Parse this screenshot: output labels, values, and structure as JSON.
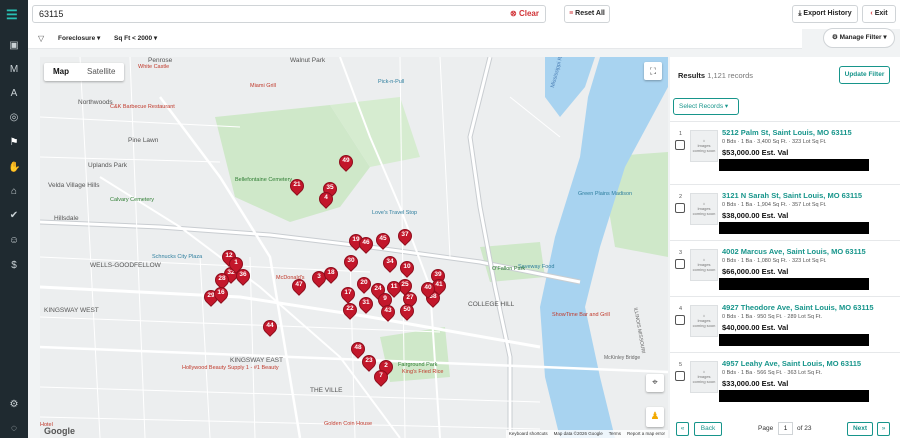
{
  "nav": {
    "logo": "☰",
    "items": [
      {
        "name": "dashboard-icon",
        "glyph": "▣"
      },
      {
        "name": "marketing-icon",
        "glyph": "M"
      },
      {
        "name": "ai-icon",
        "glyph": "A"
      },
      {
        "name": "target-icon",
        "glyph": "◎"
      },
      {
        "name": "property-search-icon",
        "glyph": "⚑"
      },
      {
        "name": "hand-icon",
        "glyph": "✋"
      },
      {
        "name": "home-icon",
        "glyph": "⌂"
      },
      {
        "name": "check-circle-icon",
        "glyph": "✔"
      },
      {
        "name": "user-icon",
        "glyph": "☺"
      },
      {
        "name": "dollar-icon",
        "glyph": "$"
      },
      {
        "name": "settings-icon",
        "glyph": "⚙"
      },
      {
        "name": "support-icon",
        "glyph": "◌"
      }
    ]
  },
  "search": {
    "value": "63115",
    "clear_label": "Clear"
  },
  "toolbar": {
    "reset_label": "Reset All",
    "export_label": "Export History",
    "exit_label": "Exit"
  },
  "filters": [
    {
      "label": "Foreclosure"
    },
    {
      "label": "Sq Ft < 2000"
    }
  ],
  "manage_filter_label": "Manage Filter",
  "map": {
    "tab_map": "Map",
    "tab_satellite": "Satellite",
    "google": "Google",
    "footer": [
      "Keyboard shortcuts",
      "Map data ©2026 Google",
      "Terms",
      "Report a map error"
    ],
    "labels": [
      {
        "text": "Northwoods",
        "cls": "area"
      },
      {
        "text": "Pine Lawn",
        "cls": "area"
      },
      {
        "text": "Uplands Park",
        "cls": "area"
      },
      {
        "text": "Velda Village Hills",
        "cls": "area"
      },
      {
        "text": "Hillsdale",
        "cls": "area"
      },
      {
        "text": "WELLS-GOODFELLOW",
        "cls": "area"
      },
      {
        "text": "KINGSWAY WEST",
        "cls": "area"
      },
      {
        "text": "KINGSWAY EAST",
        "cls": "area"
      },
      {
        "text": "COLLEGE HILL",
        "cls": "area"
      },
      {
        "text": "THE VILLE",
        "cls": "area"
      },
      {
        "text": "Walnut Park",
        "cls": "area"
      },
      {
        "text": "Penrose",
        "cls": "area"
      },
      {
        "text": "Bellefontaine Cemetery",
        "cls": "green"
      },
      {
        "text": "Calvary Cemetery",
        "cls": "green"
      },
      {
        "text": "White Castle",
        "cls": "poi"
      },
      {
        "text": "Miami Grill",
        "cls": "poi"
      },
      {
        "text": "Pick-n-Pull",
        "cls": "poi2"
      },
      {
        "text": "C&K Barbecue Restaurant",
        "cls": "poi"
      },
      {
        "text": "Schnucks City Plaza",
        "cls": "poi2"
      },
      {
        "text": "McDonald's",
        "cls": "poi"
      },
      {
        "text": "Love's Travel Stop",
        "cls": "poi2"
      },
      {
        "text": "Saveway Food",
        "cls": "poi2"
      },
      {
        "text": "O'Fallon Park",
        "cls": "green"
      },
      {
        "text": "ShowTime Bar and Grill",
        "cls": "poi"
      },
      {
        "text": "Fairground Park",
        "cls": "green"
      },
      {
        "text": "King's Fried Rice",
        "cls": "poi"
      },
      {
        "text": "Hollywood Beauty Supply 1 - #1 Beauty",
        "cls": "poi"
      },
      {
        "text": "Golden Coin House",
        "cls": "poi"
      },
      {
        "text": "Green Plains Madison",
        "cls": "poi2"
      },
      {
        "text": "McKinley Bridge",
        "cls": "road"
      },
      {
        "text": "Mississippi River",
        "cls": "water"
      },
      {
        "text": "ILLINOIS MISSOURI",
        "cls": "road"
      },
      {
        "text": "Hotel",
        "cls": "poi"
      }
    ],
    "markers": [
      "49",
      "21",
      "35",
      "4",
      "19",
      "46",
      "45",
      "37",
      "34",
      "10",
      "30",
      "12",
      "32",
      "36",
      "1",
      "28",
      "29",
      "16",
      "3",
      "18",
      "47",
      "39",
      "41",
      "20",
      "17",
      "24",
      "27",
      "25",
      "22",
      "31",
      "9",
      "43",
      "50",
      "38",
      "44",
      "48",
      "23",
      "2",
      "7",
      "40",
      "11"
    ]
  },
  "results": {
    "title": "Results",
    "count": "1,121 records",
    "update_label": "Update Filter",
    "select_label": "Select Records",
    "thumb_text": "Images coming soon",
    "items": [
      {
        "index": "1",
        "address": "5212 Palm St, Saint Louis, MO 63115",
        "meta": "0 Bds · 1 Ba · 3,400 Sq Ft. · 323 Lot Sq Ft.",
        "price": "$53,000.00 Est. Val"
      },
      {
        "index": "2",
        "address": "3121 N Sarah St, Saint Louis, MO 63115",
        "meta": "0 Bds · 1 Ba · 1,904 Sq Ft. · 357 Lot Sq Ft.",
        "price": "$38,000.00 Est. Val"
      },
      {
        "index": "3",
        "address": "4002 Marcus Ave, Saint Louis, MO 63115",
        "meta": "0 Bds · 1 Ba · 1,080 Sq Ft. · 323 Lot Sq Ft.",
        "price": "$66,000.00 Est. Val"
      },
      {
        "index": "4",
        "address": "4927 Theodore Ave, Saint Louis, MO 63115",
        "meta": "0 Bds · 1 Ba · 950 Sq Ft. · 289 Lot Sq Ft.",
        "price": "$40,000.00 Est. Val"
      },
      {
        "index": "5",
        "address": "4957 Leahy Ave, Saint Louis, MO 63115",
        "meta": "0 Bds · 1 Ba · 566 Sq Ft. · 363 Lot Sq Ft.",
        "price": "$33,000.00 Est. Val"
      }
    ]
  },
  "pager": {
    "first": "«",
    "back": "Back",
    "page_label": "Page",
    "page": "1",
    "of": "of 23",
    "next": "Next",
    "last": "»"
  }
}
